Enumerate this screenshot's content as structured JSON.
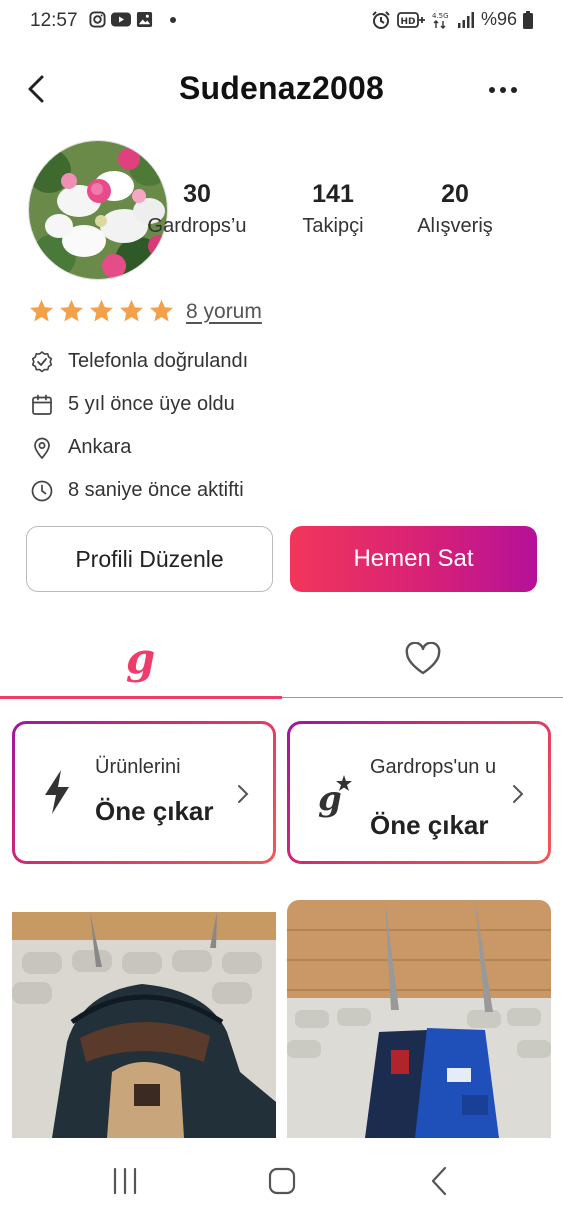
{
  "status_bar": {
    "time": "12:57",
    "battery": "%96",
    "icons": [
      "instagram-icon",
      "youtube-icon",
      "gallery-icon",
      "alarm-icon",
      "hd-icon",
      "signal-icon",
      "battery-icon"
    ]
  },
  "header": {
    "title": "Sudenaz2008"
  },
  "stats": [
    {
      "value": "30",
      "label": "Gardrops’u"
    },
    {
      "value": "141",
      "label": "Takipçi"
    },
    {
      "value": "20",
      "label": "Alışveriş"
    }
  ],
  "rating": {
    "stars": 5,
    "review_link": "8 yorum",
    "color": "#f4a14a"
  },
  "info": [
    {
      "icon": "verified-icon",
      "text": "Telefonla doğrulandı"
    },
    {
      "icon": "calendar-icon",
      "text": "5 yıl önce üye oldu"
    },
    {
      "icon": "location-pin-icon",
      "text": "Ankara"
    },
    {
      "icon": "clock-icon",
      "text": "8 saniye önce aktifti"
    }
  ],
  "buttons": {
    "edit_profile": "Profili Düzenle",
    "sell_now": "Hemen Sat"
  },
  "tabs": {
    "wardrobe_glyph": "g",
    "active_tab": "wardrobe"
  },
  "promos": [
    {
      "line1": "Ürünlerini",
      "line2": "Öne çıkar",
      "icon": "lightning-icon"
    },
    {
      "line1": "Gardrops'un u",
      "line2": "Öne çıkar",
      "icon": "g-star-icon"
    }
  ],
  "colors": {
    "accent": "#ee3c6b",
    "gradient_start": "#f2365a",
    "gradient_end": "#b5109a"
  }
}
